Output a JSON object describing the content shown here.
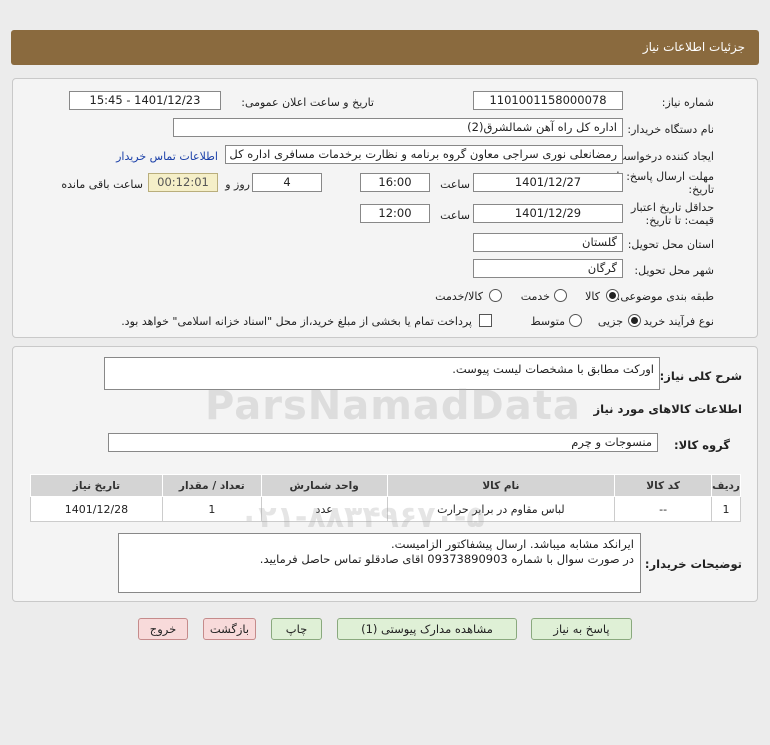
{
  "header": {
    "title": "جزئیات اطلاعات نیاز"
  },
  "fields": {
    "need_number_label": "شماره نیاز:",
    "need_number": "1101001158000078",
    "announce_label": "تاریخ و ساعت اعلان عمومی:",
    "announce_value": "1401/12/23 - 15:45",
    "buyer_org_label": "نام دستگاه خریدار:",
    "buyer_org": "اداره کل راه آهن شمالشرق(2)",
    "creator_label": "ایجاد کننده درخواست:",
    "creator": "رمضانعلی نوری سراجی معاون گروه برنامه و نظارت برخدمات مسافری اداره کل راه",
    "contact_link": "اطلاعات تماس خریدار",
    "deadline_label_1": "مهلت ارسال پاسخ: تا",
    "deadline_label_2": "تاریخ:",
    "deadline_date": "1401/12/27",
    "time_label": "ساعت",
    "deadline_time": "16:00",
    "days_value": "4",
    "days_label": "روز و",
    "remaining_time": "00:12:01",
    "remaining_label": "ساعت باقی مانده",
    "validity_label_1": "حداقل تاریخ اعتبار",
    "validity_label_2": "قیمت: تا تاریخ:",
    "validity_date": "1401/12/29",
    "validity_time": "12:00",
    "province_label": "استان محل تحویل:",
    "province": "گلستان",
    "city_label": "شهر محل تحویل:",
    "city": "گرگان",
    "category_label": "طبقه بندی موضوعی:",
    "category_options": [
      "کالا",
      "خدمت",
      "کالا/خدمت"
    ],
    "process_label": "نوع فرآیند خرید :",
    "process_options": [
      "جزیی",
      "متوسط"
    ],
    "payment_note": "پرداخت تمام یا بخشی از مبلغ خرید،از محل \"اسناد خزانه اسلامی\" خواهد بود."
  },
  "description": {
    "label": "شرح کلی نیاز:",
    "value": "اورکت مطابق با مشخصات لیست پیوست."
  },
  "goods": {
    "section_title": "اطلاعات کالاهای مورد نیاز",
    "group_label": "گروه کالا:",
    "group_value": "منسوجات و چرم",
    "columns": [
      "ردیف",
      "کد کالا",
      "نام کالا",
      "واحد شمارش",
      "تعداد / مقدار",
      "تاریخ نیاز"
    ],
    "rows": [
      [
        "1",
        "--",
        "لباس مقاوم در برابر حرارت",
        "عدد",
        "1",
        "1401/12/28"
      ]
    ]
  },
  "buyer_notes": {
    "label": "توضیحات خریدار:",
    "line1": "ایرانکد مشابه میباشد. ارسال پیشفاکتور الزامیست.",
    "line2": "در صورت سوال با شماره  09373890903  اقای صادقلو تماس حاصل فرمایید."
  },
  "buttons": {
    "reply": "پاسخ به نیاز",
    "attachments": "مشاهده مدارک پیوستی (1)",
    "print": "چاپ",
    "back": "بازگشت",
    "exit": "خروج"
  },
  "watermark": {
    "brand": "ParsNamadData",
    "phone": "۰۲۱-۸۸۳۴۹۶۷۰-۵"
  }
}
